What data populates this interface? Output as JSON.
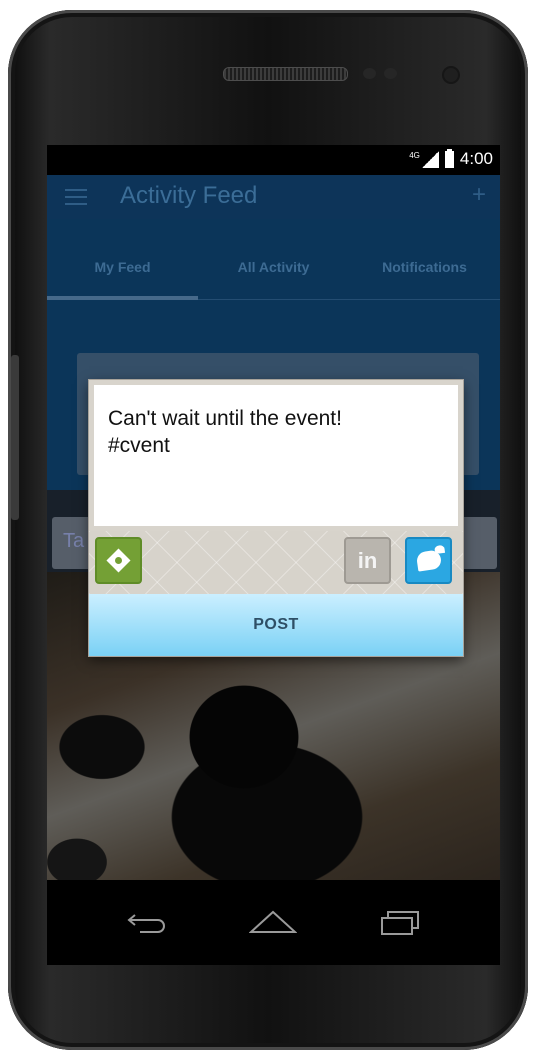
{
  "status_bar": {
    "network": "4G",
    "time": "4:00"
  },
  "app_bar": {
    "title": "Activity Feed",
    "add_label": "+"
  },
  "tabs": [
    {
      "label": "My Feed",
      "active": true
    },
    {
      "label": "All Activity",
      "active": false
    },
    {
      "label": "Notifications",
      "active": false
    }
  ],
  "background": {
    "tags_field_text": "Ta"
  },
  "post_dialog": {
    "text": "Can't wait until the event!\n#cvent",
    "linkedin_label": "in",
    "post_label": "POST"
  },
  "icons": {
    "menu": "hamburger-icon",
    "add": "plus-icon",
    "location": "compass-location-icon",
    "linkedin": "linkedin-icon",
    "twitter": "twitter-bird-icon",
    "back": "back-icon",
    "home": "home-icon",
    "recents": "recent-apps-icon"
  },
  "colors": {
    "app_bar": "#0d3459",
    "location_button": "#74a035",
    "twitter_button": "#2ba7e2",
    "post_button": "#8fd8f7"
  }
}
